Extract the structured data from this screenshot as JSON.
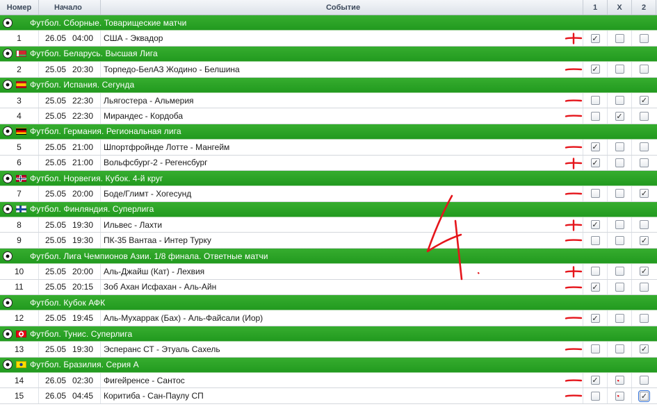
{
  "columns": {
    "num": "Номер",
    "start": "Начало",
    "event": "Событие",
    "c1": "1",
    "cx": "X",
    "c2": "2"
  },
  "groups": [
    {
      "title": "Футбол. Сборные. Товарищеские матчи",
      "flag": "",
      "matches": [
        {
          "num": "1",
          "date": "26.05",
          "time": "04:00",
          "event": "США - Эквадор",
          "picks": [
            true,
            false,
            false
          ]
        }
      ]
    },
    {
      "title": "Футбол. Беларусь. Высшая Лига",
      "flag": "by",
      "matches": [
        {
          "num": "2",
          "date": "25.05",
          "time": "20:30",
          "event": "Торпедо-БелАЗ Жодино - Белшина",
          "picks": [
            true,
            false,
            false
          ]
        }
      ]
    },
    {
      "title": "Футбол. Испания. Сегунда",
      "flag": "es",
      "matches": [
        {
          "num": "3",
          "date": "25.05",
          "time": "22:30",
          "event": "Льягостера - Альмерия",
          "picks": [
            false,
            false,
            true
          ]
        },
        {
          "num": "4",
          "date": "25.05",
          "time": "22:30",
          "event": "Мирандес - Кордоба",
          "picks": [
            false,
            true,
            false
          ]
        }
      ]
    },
    {
      "title": "Футбол. Германия. Региональная лига",
      "flag": "de",
      "matches": [
        {
          "num": "5",
          "date": "25.05",
          "time": "21:00",
          "event": "Шпортфройнде Лотте - Мангейм",
          "picks": [
            true,
            false,
            false
          ]
        },
        {
          "num": "6",
          "date": "25.05",
          "time": "21:00",
          "event": "Вольфсбург-2 - Регенсбург",
          "picks": [
            true,
            false,
            false
          ]
        }
      ]
    },
    {
      "title": "Футбол. Норвегия. Кубок. 4-й круг",
      "flag": "no",
      "matches": [
        {
          "num": "7",
          "date": "25.05",
          "time": "20:00",
          "event": "Боде/Глимт - Хогесунд",
          "picks": [
            false,
            false,
            true
          ]
        }
      ]
    },
    {
      "title": "Футбол. Финляндия. Суперлига",
      "flag": "fi",
      "matches": [
        {
          "num": "8",
          "date": "25.05",
          "time": "19:30",
          "event": "Ильвес - Лахти",
          "picks": [
            true,
            false,
            false
          ]
        },
        {
          "num": "9",
          "date": "25.05",
          "time": "19:30",
          "event": "ПК-35 Вантаа - Интер Турку",
          "picks": [
            false,
            false,
            true
          ]
        }
      ]
    },
    {
      "title": "Футбол. Лига Чемпионов Азии. 1/8 финала. Ответные матчи",
      "flag": "",
      "matches": [
        {
          "num": "10",
          "date": "25.05",
          "time": "20:00",
          "event": "Аль-Джайш (Кат) - Лехвия",
          "picks": [
            false,
            false,
            true
          ]
        },
        {
          "num": "11",
          "date": "25.05",
          "time": "20:15",
          "event": "Зоб Ахан Исфахан - Аль-Айн",
          "picks": [
            true,
            false,
            false
          ]
        }
      ]
    },
    {
      "title": "Футбол. Кубок АФК",
      "flag": "",
      "matches": [
        {
          "num": "12",
          "date": "25.05",
          "time": "19:45",
          "event": "Аль-Мухаррак (Бах) - Аль-Файсали (Иор)",
          "picks": [
            true,
            false,
            false
          ]
        }
      ]
    },
    {
      "title": "Футбол. Тунис. Суперлига",
      "flag": "tn",
      "matches": [
        {
          "num": "13",
          "date": "25.05",
          "time": "19:30",
          "event": "Эсперанс СТ - Этуаль Сахель",
          "picks": [
            false,
            false,
            true
          ]
        }
      ]
    },
    {
      "title": "Футбол. Бразилия. Серия А",
      "flag": "br",
      "matches": [
        {
          "num": "14",
          "date": "26.05",
          "time": "02:30",
          "event": "Фигейренсе - Сантос",
          "picks": [
            true,
            false,
            false
          ]
        },
        {
          "num": "15",
          "date": "26.05",
          "time": "04:45",
          "event": "Коритиба - Сан-Паулу СП",
          "picks": [
            false,
            false,
            true
          ]
        }
      ]
    }
  ],
  "annotations": {
    "color": "#e5151b",
    "big_number": "4",
    "row_marks": [
      "+",
      "-",
      "-",
      "-",
      "-",
      "+",
      "-",
      "+",
      "-",
      "+",
      "-",
      "-",
      "-",
      "-",
      "-"
    ]
  }
}
